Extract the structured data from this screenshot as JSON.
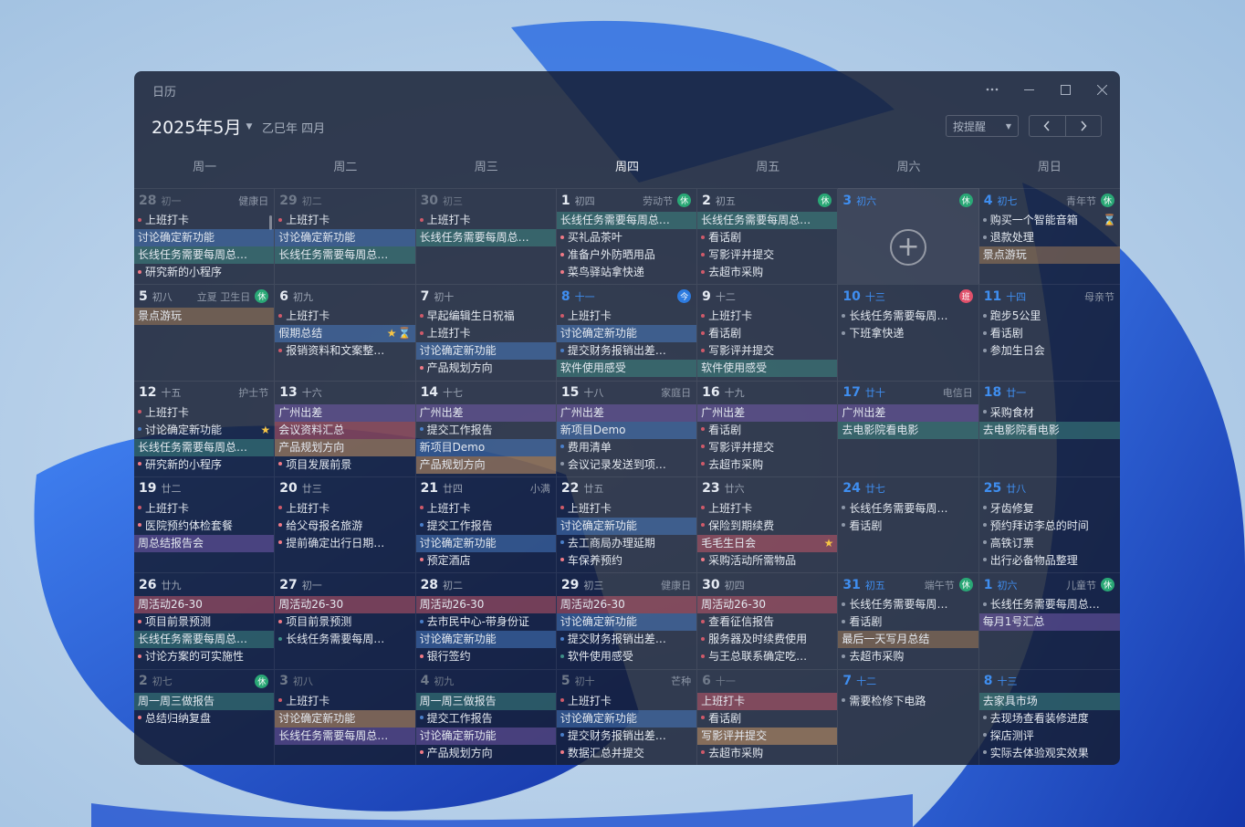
{
  "window": {
    "title": "日历"
  },
  "header": {
    "month": "2025年5月",
    "lunar": "乙巳年 四月",
    "filter": "按提醒"
  },
  "weekdays": [
    "周一",
    "周二",
    "周三",
    "周四",
    "周五",
    "周六",
    "周日"
  ],
  "colors": {
    "red": "#cf5a6a",
    "pink": "#f07a86",
    "orange": "#d9a066",
    "gold": "#f6c445",
    "green": "#3fae8d",
    "teal": "#3e8e86",
    "blue": "#4a7fc9",
    "purple": "#7a5db4",
    "gray": "#8d97a8",
    "brown": "#a98056"
  },
  "days": [
    {
      "d": "28",
      "l": "初一",
      "h": "健康日",
      "other": true,
      "ev": [
        {
          "t": "上班打卡",
          "c": "red"
        },
        {
          "t": "讨论确定新功能",
          "c": "blue",
          "f": 1
        },
        {
          "t": "长线任务需要每周总结...",
          "c": "teal",
          "f": 1
        },
        {
          "t": "研究新的小程序",
          "c": "pink"
        }
      ]
    },
    {
      "d": "29",
      "l": "初二",
      "other": true,
      "ev": [
        {
          "t": "上班打卡",
          "c": "red"
        },
        {
          "t": "讨论确定新功能",
          "c": "blue",
          "f": 1
        },
        {
          "t": "长线任务需要每周总结...",
          "c": "teal",
          "f": 1
        }
      ]
    },
    {
      "d": "30",
      "l": "初三",
      "other": true,
      "ev": [
        {
          "t": "上班打卡",
          "c": "red"
        },
        {
          "t": "长线任务需要每周总结...",
          "c": "teal",
          "f": 1
        }
      ]
    },
    {
      "d": "1",
      "l": "初四",
      "h": "劳动节",
      "b": "休",
      "ev": [
        {
          "t": "长线任务需要每周总结...",
          "c": "teal",
          "f": 1
        },
        {
          "t": "买礼品茶叶",
          "c": "pink"
        },
        {
          "t": "准备户外防晒用品",
          "c": "pink"
        },
        {
          "t": "菜鸟驿站拿快递",
          "c": "pink"
        }
      ]
    },
    {
      "d": "2",
      "l": "初五",
      "b": "休",
      "ev": [
        {
          "t": "长线任务需要每周总结...",
          "c": "teal",
          "f": 1
        },
        {
          "t": "看话剧",
          "c": "red"
        },
        {
          "t": "写影评并提交",
          "c": "red"
        },
        {
          "t": "去超市采购",
          "c": "red"
        }
      ]
    },
    {
      "d": "3",
      "l": "初六",
      "b": "休",
      "wk": true,
      "sel": true,
      "add": true,
      "ev": []
    },
    {
      "d": "4",
      "l": "初七",
      "h": "青年节",
      "b": "休",
      "wk": true,
      "ev": [
        {
          "t": "购买一个智能音箱",
          "c": "gray",
          "i": "hour"
        },
        {
          "t": "退款处理",
          "c": "gray"
        },
        {
          "t": "景点游玩",
          "c": "brown",
          "f": 1
        }
      ]
    },
    {
      "d": "5",
      "l": "初八",
      "h": "立夏 卫生日",
      "b": "休",
      "ev": [
        {
          "t": "景点游玩",
          "c": "brown",
          "f": 1
        }
      ]
    },
    {
      "d": "6",
      "l": "初九",
      "ev": [
        {
          "t": "上班打卡",
          "c": "red"
        },
        {
          "t": "假期总结",
          "c": "blue",
          "f": 1,
          "i": "hour",
          "i2": "star"
        },
        {
          "t": "报销资料和文案整理素...",
          "c": "red"
        }
      ]
    },
    {
      "d": "7",
      "l": "初十",
      "ev": [
        {
          "t": "早起编辑生日祝福",
          "c": "red"
        },
        {
          "t": "上班打卡",
          "c": "red"
        },
        {
          "t": "讨论确定新功能",
          "c": "blue",
          "f": 1
        },
        {
          "t": "产品规划方向",
          "c": "pink"
        }
      ]
    },
    {
      "d": "8",
      "l": "十一",
      "b": "今",
      "today": true,
      "ev": [
        {
          "t": "上班打卡",
          "c": "red"
        },
        {
          "t": "讨论确定新功能",
          "c": "blue",
          "f": 1
        },
        {
          "t": "提交财务报销出差费用",
          "c": "blue"
        },
        {
          "t": "软件使用感受",
          "c": "teal",
          "f": 1
        }
      ]
    },
    {
      "d": "9",
      "l": "十二",
      "ev": [
        {
          "t": "上班打卡",
          "c": "red"
        },
        {
          "t": "看话剧",
          "c": "red"
        },
        {
          "t": "写影评并提交",
          "c": "red"
        },
        {
          "t": "软件使用感受",
          "c": "teal",
          "f": 1
        }
      ]
    },
    {
      "d": "10",
      "l": "十三",
      "b": "班",
      "wk": true,
      "ev": [
        {
          "t": "长线任务需要每周总结...",
          "c": "gray"
        },
        {
          "t": "下班拿快递",
          "c": "gray"
        }
      ]
    },
    {
      "d": "11",
      "l": "十四",
      "h": "母亲节",
      "wk": true,
      "ev": [
        {
          "t": "跑步5公里",
          "c": "gray"
        },
        {
          "t": "看话剧",
          "c": "gray"
        },
        {
          "t": "参加生日会",
          "c": "gray"
        }
      ]
    },
    {
      "d": "12",
      "l": "十五",
      "h": "护士节",
      "ev": [
        {
          "t": "上班打卡",
          "c": "red"
        },
        {
          "t": "讨论确定新功能",
          "c": "blue",
          "i": "star"
        },
        {
          "t": "长线任务需要每周总结...",
          "c": "teal",
          "f": 1
        },
        {
          "t": "研究新的小程序",
          "c": "pink"
        }
      ]
    },
    {
      "d": "13",
      "l": "十六",
      "ev": [
        {
          "t": "广州出差",
          "c": "purple",
          "f": 1
        },
        {
          "t": "会议资料汇总",
          "c": "red",
          "f": 1
        },
        {
          "t": "产品规划方向",
          "c": "orange",
          "f": 1
        },
        {
          "t": "项目发展前景",
          "c": "pink"
        }
      ]
    },
    {
      "d": "14",
      "l": "十七",
      "ev": [
        {
          "t": "广州出差",
          "c": "purple",
          "f": 1
        },
        {
          "t": "提交工作报告",
          "c": "blue"
        },
        {
          "t": "新项目Demo",
          "c": "blue",
          "f": 1
        },
        {
          "t": "产品规划方向",
          "c": "orange",
          "f": 1
        }
      ]
    },
    {
      "d": "15",
      "l": "十八",
      "h": "家庭日",
      "ev": [
        {
          "t": "广州出差",
          "c": "purple",
          "f": 1
        },
        {
          "t": "新项目Demo",
          "c": "blue",
          "f": 1
        },
        {
          "t": "费用清单",
          "c": "blue"
        },
        {
          "t": "会议记录发送到项目...",
          "c": "gray"
        }
      ]
    },
    {
      "d": "16",
      "l": "十九",
      "ev": [
        {
          "t": "广州出差",
          "c": "purple",
          "f": 1
        },
        {
          "t": "看话剧",
          "c": "red"
        },
        {
          "t": "写影评并提交",
          "c": "red"
        },
        {
          "t": "去超市采购",
          "c": "red"
        }
      ]
    },
    {
      "d": "17",
      "l": "廿十",
      "h": "电信日",
      "wk": true,
      "ev": [
        {
          "t": "广州出差",
          "c": "purple",
          "f": 1
        },
        {
          "t": "去电影院看电影",
          "c": "teal",
          "f": 1
        }
      ]
    },
    {
      "d": "18",
      "l": "廿一",
      "wk": true,
      "ev": [
        {
          "t": "采购食材",
          "c": "gray"
        },
        {
          "t": "去电影院看电影",
          "c": "teal",
          "f": 1
        }
      ]
    },
    {
      "d": "19",
      "l": "廿二",
      "ev": [
        {
          "t": "上班打卡",
          "c": "red"
        },
        {
          "t": "医院预约体检套餐",
          "c": "pink"
        },
        {
          "t": "周总结报告会",
          "c": "purple",
          "f": 1
        }
      ]
    },
    {
      "d": "20",
      "l": "廿三",
      "ev": [
        {
          "t": "上班打卡",
          "c": "red"
        },
        {
          "t": "给父母报名旅游",
          "c": "pink"
        },
        {
          "t": "提前确定出行日期与人...",
          "c": "pink"
        }
      ]
    },
    {
      "d": "21",
      "l": "廿四",
      "h": "小满",
      "ev": [
        {
          "t": "上班打卡",
          "c": "red"
        },
        {
          "t": "提交工作报告",
          "c": "blue"
        },
        {
          "t": "讨论确定新功能",
          "c": "blue",
          "f": 1
        },
        {
          "t": "预定酒店",
          "c": "pink"
        }
      ]
    },
    {
      "d": "22",
      "l": "廿五",
      "ev": [
        {
          "t": "上班打卡",
          "c": "red"
        },
        {
          "t": "讨论确定新功能",
          "c": "blue",
          "f": 1
        },
        {
          "t": "去工商局办理延期",
          "c": "blue"
        },
        {
          "t": "车保养预约",
          "c": "pink"
        }
      ]
    },
    {
      "d": "23",
      "l": "廿六",
      "ev": [
        {
          "t": "上班打卡",
          "c": "red"
        },
        {
          "t": "保险到期续费",
          "c": "red"
        },
        {
          "t": "毛毛生日会",
          "c": "red",
          "f": 1,
          "i": "star"
        },
        {
          "t": "采购活动所需物品",
          "c": "pink"
        }
      ]
    },
    {
      "d": "24",
      "l": "廿七",
      "wk": true,
      "ev": [
        {
          "t": "长线任务需要每周总结...",
          "c": "gray"
        },
        {
          "t": "看话剧",
          "c": "gray"
        }
      ]
    },
    {
      "d": "25",
      "l": "廿八",
      "wk": true,
      "ev": [
        {
          "t": "牙齿修复",
          "c": "gray"
        },
        {
          "t": "预约拜访李总的时间",
          "c": "gray"
        },
        {
          "t": "高铁订票",
          "c": "gray"
        },
        {
          "t": "出行必备物品整理",
          "c": "gray"
        }
      ]
    },
    {
      "d": "26",
      "l": "廿九",
      "ev": [
        {
          "t": "周活动26-30",
          "c": "red",
          "f": 1
        },
        {
          "t": "项目前景预测",
          "c": "pink"
        },
        {
          "t": "长线任务需要每周总结...",
          "c": "teal",
          "f": 1
        },
        {
          "t": "讨论方案的可实施性",
          "c": "pink"
        }
      ]
    },
    {
      "d": "27",
      "l": "初一",
      "ev": [
        {
          "t": "周活动26-30",
          "c": "red",
          "f": 1
        },
        {
          "t": "项目前景预测",
          "c": "pink"
        },
        {
          "t": "长线任务需要每周总结...",
          "c": "teal"
        }
      ]
    },
    {
      "d": "28",
      "l": "初二",
      "ev": [
        {
          "t": "周活动26-30",
          "c": "red",
          "f": 1
        },
        {
          "t": "去市民中心-带身份证",
          "c": "blue"
        },
        {
          "t": "讨论确定新功能",
          "c": "blue",
          "f": 1
        },
        {
          "t": "银行签约",
          "c": "pink"
        }
      ]
    },
    {
      "d": "29",
      "l": "初三",
      "h": "健康日",
      "ev": [
        {
          "t": "周活动26-30",
          "c": "red",
          "f": 1
        },
        {
          "t": "讨论确定新功能",
          "c": "blue",
          "f": 1
        },
        {
          "t": "提交财务报销出差费用",
          "c": "blue"
        },
        {
          "t": "软件使用感受",
          "c": "teal"
        }
      ]
    },
    {
      "d": "30",
      "l": "初四",
      "ev": [
        {
          "t": "周活动26-30",
          "c": "red",
          "f": 1
        },
        {
          "t": "查看征信报告",
          "c": "red"
        },
        {
          "t": "服务器及时续费使用",
          "c": "red"
        },
        {
          "t": "与王总联系确定吃饭时间",
          "c": "red"
        }
      ]
    },
    {
      "d": "31",
      "l": "初五",
      "h": "端午节",
      "b": "休",
      "wk": true,
      "ev": [
        {
          "t": "长线任务需要每周总结...",
          "c": "gray"
        },
        {
          "t": "看话剧",
          "c": "gray"
        },
        {
          "t": "最后一天写月总结",
          "c": "brown",
          "f": 1
        },
        {
          "t": "去超市采购",
          "c": "gray"
        }
      ]
    },
    {
      "d": "1",
      "l": "初六",
      "h": "儿童节",
      "b": "休",
      "wk": true,
      "ev": [
        {
          "t": "长线任务需要每周总结...",
          "c": "gray"
        },
        {
          "t": "每月1号汇总",
          "c": "purple",
          "f": 1
        }
      ]
    },
    {
      "d": "2",
      "l": "初七",
      "b": "休",
      "other": true,
      "ev": [
        {
          "t": "周一周三做报告",
          "c": "teal",
          "f": 1
        },
        {
          "t": "总结归纳复盘",
          "c": "pink"
        }
      ]
    },
    {
      "d": "3",
      "l": "初八",
      "other": true,
      "ev": [
        {
          "t": "上班打卡",
          "c": "red"
        },
        {
          "t": "讨论确定新功能",
          "c": "orange",
          "f": 1
        },
        {
          "t": "长线任务需要每周总结...",
          "c": "purple",
          "f": 1
        }
      ]
    },
    {
      "d": "4",
      "l": "初九",
      "other": true,
      "ev": [
        {
          "t": "周一周三做报告",
          "c": "teal",
          "f": 1
        },
        {
          "t": "提交工作报告",
          "c": "blue"
        },
        {
          "t": "讨论确定新功能",
          "c": "purple",
          "f": 1
        },
        {
          "t": "产品规划方向",
          "c": "pink"
        }
      ]
    },
    {
      "d": "5",
      "l": "初十",
      "h": "芒种",
      "other": true,
      "ev": [
        {
          "t": "上班打卡",
          "c": "red"
        },
        {
          "t": "讨论确定新功能",
          "c": "blue",
          "f": 1
        },
        {
          "t": "提交财务报销出差费用",
          "c": "blue"
        },
        {
          "t": "数据汇总并提交",
          "c": "pink"
        }
      ]
    },
    {
      "d": "6",
      "l": "十一",
      "other": true,
      "ev": [
        {
          "t": "上班打卡",
          "c": "red",
          "f": 1
        },
        {
          "t": "看话剧",
          "c": "red"
        },
        {
          "t": "写影评并提交",
          "c": "orange",
          "f": 1
        },
        {
          "t": "去超市采购",
          "c": "red"
        }
      ]
    },
    {
      "d": "7",
      "l": "十二",
      "other": true,
      "wk": true,
      "ev": [
        {
          "t": "需要检修下电路",
          "c": "gray"
        }
      ]
    },
    {
      "d": "8",
      "l": "十三",
      "other": true,
      "wk": true,
      "ev": [
        {
          "t": "去家具市场",
          "c": "teal",
          "f": 1
        },
        {
          "t": "去现场查看装修进度",
          "c": "gray"
        },
        {
          "t": "探店测评",
          "c": "gray"
        },
        {
          "t": "实际去体验观实效果",
          "c": "gray"
        }
      ]
    }
  ]
}
